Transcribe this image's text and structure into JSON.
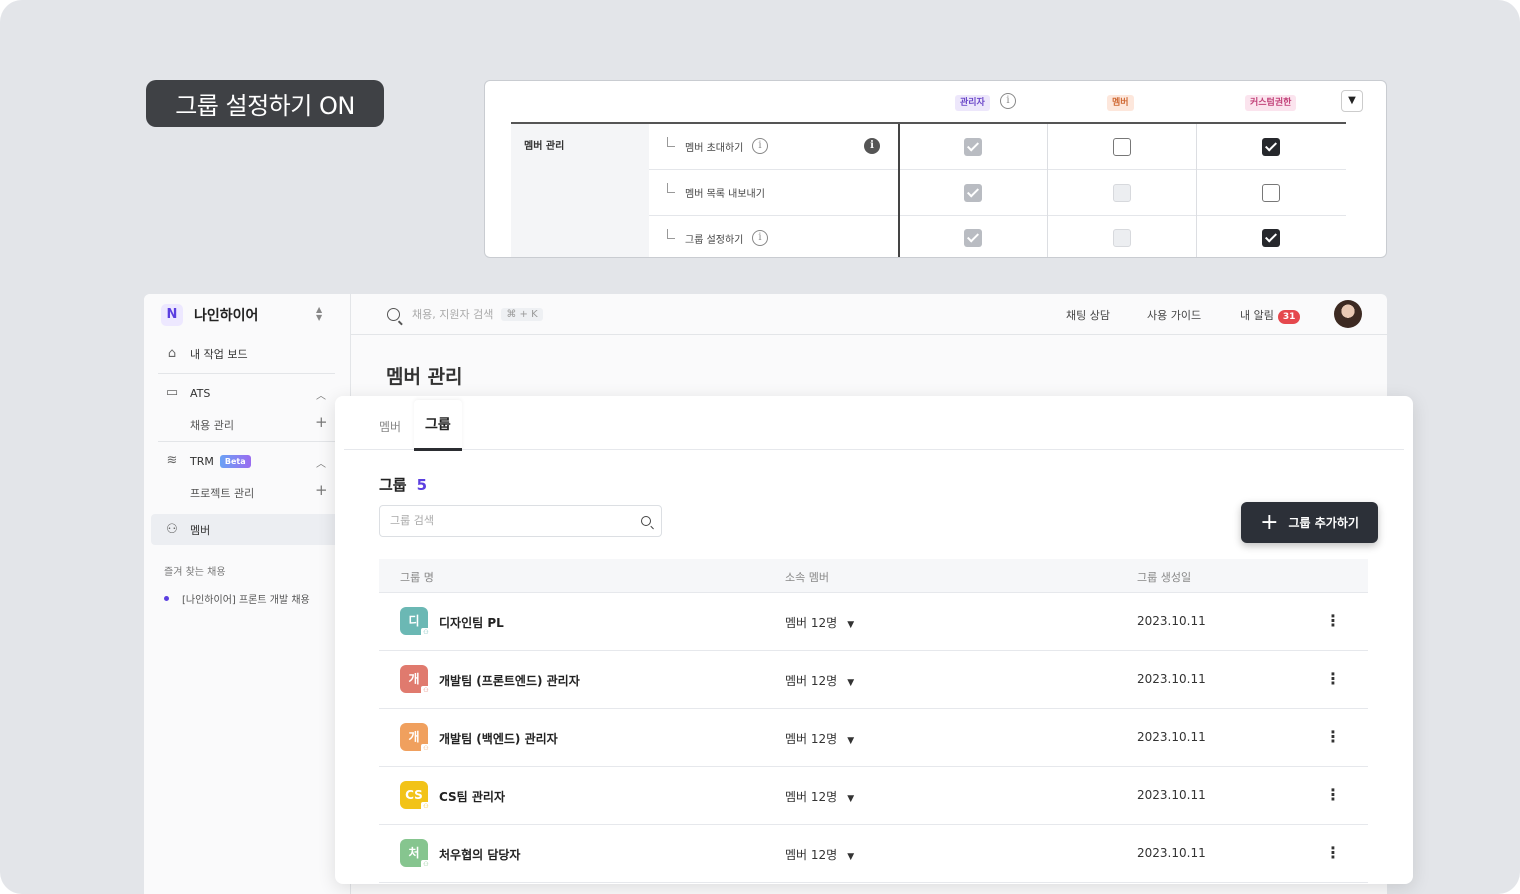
{
  "banner": {
    "label": "그룹 설정하기 ON"
  },
  "permissions": {
    "roles": {
      "admin": "관리자",
      "member": "멤버",
      "custom": "커스텀권한"
    },
    "dropdown_icon": "▼",
    "group_label": "멤버 관리",
    "rows": [
      {
        "label": "멤버 초대하기",
        "admin": "checked-disabled",
        "member": "unchecked",
        "custom": "checked"
      },
      {
        "label": "멤버 목록 내보내기",
        "admin": "checked-disabled",
        "member": "disabled",
        "custom": "unchecked"
      },
      {
        "label": "그룹 설정하기",
        "admin": "checked-disabled",
        "member": "disabled",
        "custom": "checked"
      }
    ]
  },
  "sidebar": {
    "brand_logo": "N",
    "workspace": "나인하이어",
    "switch_icon": "▲▼",
    "home": "내 작업 보드",
    "ats": "ATS",
    "ats_sub": "채용 관리",
    "trm": "TRM",
    "trm_badge": "Beta",
    "trm_sub": "프로젝트 관리",
    "members": "멤버",
    "favorites_title": "즐겨 찾는 채용",
    "favorite_item": "[나인하이어] 프론트 개발 채용"
  },
  "topbar": {
    "search_placeholder": "채용, 지원자 검색",
    "shortcut": "⌘ + K",
    "chat": "채팅 상담",
    "guide": "사용 가이드",
    "notifications": "내 알림",
    "notif_count": "31"
  },
  "page": {
    "title": "멤버 관리"
  },
  "tabs": {
    "members": "멤버",
    "groups": "그룹"
  },
  "groups": {
    "title": "그룹",
    "count": "5",
    "search_placeholder": "그룹 검색",
    "add_button": "그룹 추가하기",
    "add_icon": "+",
    "columns": {
      "name": "그룹 명",
      "members": "소속 멤버",
      "created": "그룹 생성일"
    },
    "rows": [
      {
        "initial": "디",
        "color": "#6bb8b4",
        "name": "디자인팀 PL",
        "members": "멤버 12명",
        "created": "2023.10.11"
      },
      {
        "initial": "개",
        "color": "#e07a6e",
        "name": "개발팀 (프론트엔드) 관리자",
        "members": "멤버 12명",
        "created": "2023.10.11"
      },
      {
        "initial": "개",
        "color": "#f0a05e",
        "name": "개발팀 (백엔드) 관리자",
        "members": "멤버 12명",
        "created": "2023.10.11"
      },
      {
        "initial": "CS",
        "color": "#f2c318",
        "name": "CS팀 관리자",
        "members": "멤버 12명",
        "created": "2023.10.11"
      },
      {
        "initial": "처",
        "color": "#86c58f",
        "name": "처우협의 담당자",
        "members": "멤버 12명",
        "created": "2023.10.11"
      }
    ]
  }
}
